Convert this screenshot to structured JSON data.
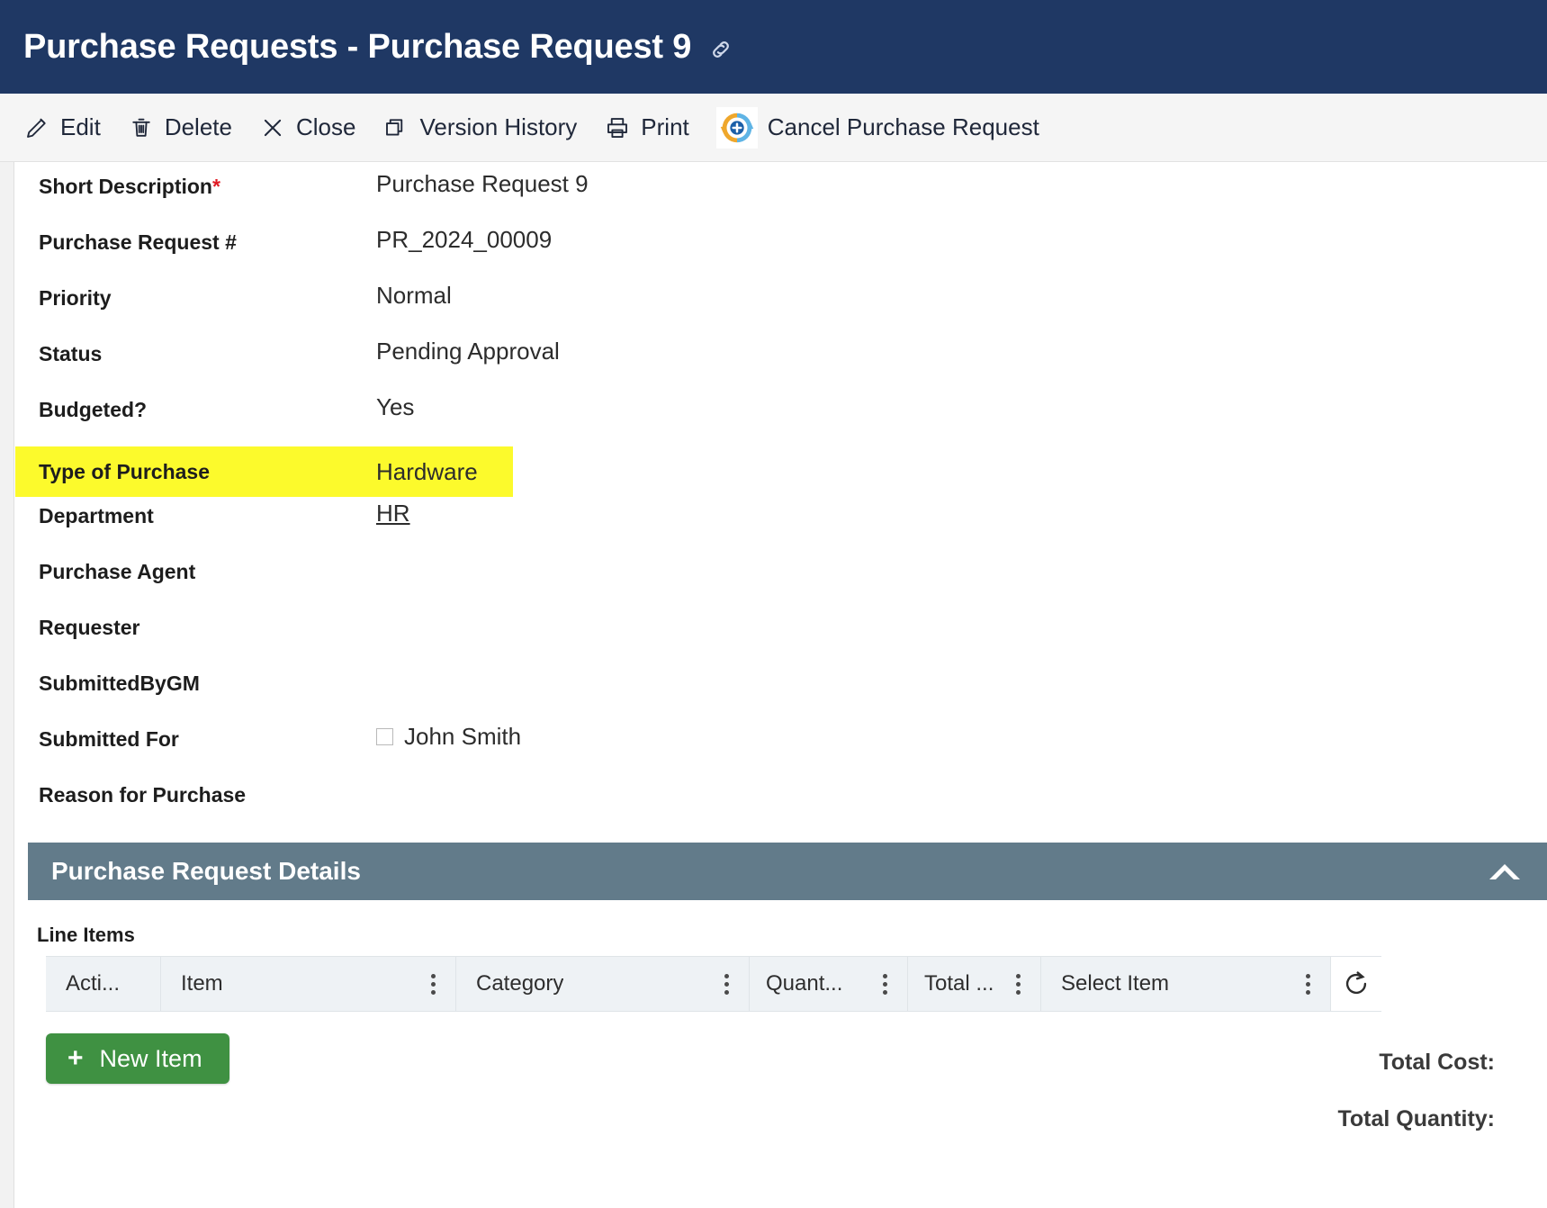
{
  "header": {
    "title": "Purchase Requests - Purchase Request 9",
    "link_icon": "link-icon",
    "bg": "#1f3864"
  },
  "toolbar": {
    "items": [
      {
        "label": "Edit",
        "icon": "pencil-icon"
      },
      {
        "label": "Delete",
        "icon": "trash-icon"
      },
      {
        "label": "Close",
        "icon": "close-x-icon"
      },
      {
        "label": "Version History",
        "icon": "version-history-icon"
      },
      {
        "label": "Print",
        "icon": "printer-icon"
      },
      {
        "label": "Cancel Purchase Request",
        "icon": "cancel-request-icon"
      }
    ]
  },
  "fields": [
    {
      "label": "Short Description",
      "required": "*",
      "value": "Purchase Request 9",
      "type": "text"
    },
    {
      "label": "Purchase Request #",
      "value": "PR_2024_00009",
      "type": "text"
    },
    {
      "label": "Priority",
      "value": "Normal",
      "type": "text"
    },
    {
      "label": "Status",
      "value": "Pending Approval",
      "type": "text"
    },
    {
      "label": "Budgeted?",
      "value": "Yes",
      "type": "text"
    },
    {
      "label": "Type of Purchase",
      "value": "Hardware",
      "type": "text",
      "highlighted": true,
      "highlight_color": "#fcfa2c"
    },
    {
      "label": "Department",
      "value": "HR",
      "type": "link"
    },
    {
      "label": "Purchase Agent",
      "value": "",
      "type": "text"
    },
    {
      "label": "Requester",
      "value": "",
      "type": "text"
    },
    {
      "label": "SubmittedByGM",
      "value": "",
      "type": "text"
    },
    {
      "label": "Submitted For",
      "value": "John Smith",
      "type": "checkbox",
      "checked": false
    },
    {
      "label": "Reason for Purchase",
      "value": "",
      "type": "text"
    }
  ],
  "section": {
    "title": "Purchase Request Details",
    "collapse_icon": "chevron-up-icon",
    "bg": "#627b8a"
  },
  "grid": {
    "caption": "Line Items",
    "columns": [
      {
        "label": "Acti...",
        "menu": false
      },
      {
        "label": "Item",
        "menu": true
      },
      {
        "label": "Category",
        "menu": true
      },
      {
        "label": "Quant...",
        "menu": true
      },
      {
        "label": "Total ...",
        "menu": true
      },
      {
        "label": "Select Item",
        "menu": true
      }
    ],
    "refresh_icon": "refresh-icon",
    "rows": []
  },
  "footer": {
    "new_item_label": "New Item",
    "new_item_plus": "+",
    "new_item_color": "#3f9142",
    "total_cost_label": "Total Cost:",
    "total_cost_value": "",
    "total_quantity_label": "Total Quantity:",
    "total_quantity_value": ""
  }
}
